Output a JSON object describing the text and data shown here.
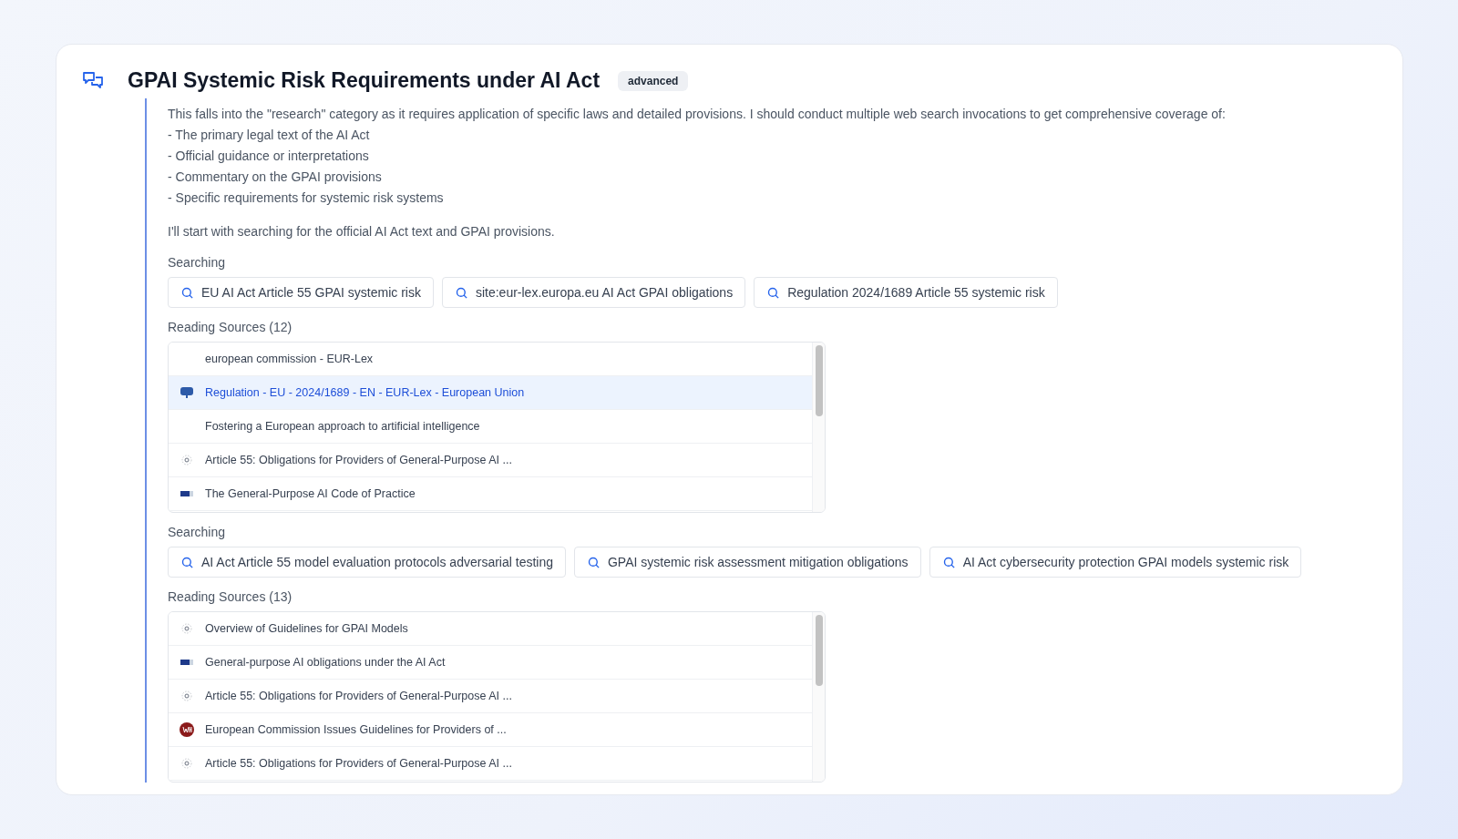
{
  "title": "GPAI Systemic Risk Requirements under AI Act",
  "badge": "advanced",
  "paragraphs": [
    "This falls into the \"research\" category as it requires application of specific laws and detailed provisions. I should conduct multiple web search invocations to get comprehensive coverage of:\n- The primary legal text of the AI Act\n- Official guidance or interpretations\n- Commentary on the GPAI provisions\n- Specific requirements for systemic risk systems",
    "I'll start with searching for the official AI Act text and GPAI provisions."
  ],
  "steps": [
    {
      "kind": "searching",
      "label": "Searching",
      "queries": [
        "EU AI Act Article 55 GPAI systemic risk",
        "site:eur-lex.europa.eu AI Act GPAI obligations",
        "Regulation 2024/1689 Article 55 systemic risk"
      ]
    },
    {
      "kind": "sources",
      "label": "Reading Sources (12)",
      "sources": [
        {
          "title": "european commission - EUR-Lex",
          "kind": "none",
          "selected": false
        },
        {
          "title": "Regulation - EU - 2024/1689 - EN - EUR-Lex - European Union",
          "kind": "monitor",
          "selected": true
        },
        {
          "title": "Fostering a European approach to artificial intelligence",
          "kind": "none",
          "selected": false
        },
        {
          "title": "Article 55: Obligations for Providers of General-Purpose AI ...",
          "kind": "dot",
          "selected": false
        },
        {
          "title": "The General-Purpose AI Code of Practice",
          "kind": "flag",
          "selected": false
        }
      ]
    },
    {
      "kind": "searching",
      "label": "Searching",
      "queries": [
        "AI Act Article 55 model evaluation protocols adversarial testing",
        "GPAI systemic risk assessment mitigation obligations",
        "AI Act cybersecurity protection GPAI models systemic risk"
      ]
    },
    {
      "kind": "sources",
      "label": "Reading Sources (13)",
      "sources": [
        {
          "title": "Overview of Guidelines for GPAI Models",
          "kind": "dot",
          "selected": false
        },
        {
          "title": "General-purpose AI obligations under the AI Act",
          "kind": "flag",
          "selected": false
        },
        {
          "title": "Article 55: Obligations for Providers of General-Purpose AI ...",
          "kind": "dot",
          "selected": false
        },
        {
          "title": "European Commission Issues Guidelines for Providers of ...",
          "kind": "badge",
          "selected": false
        },
        {
          "title": "Article 55: Obligations for Providers of General-Purpose AI ...",
          "kind": "dot",
          "selected": false
        }
      ]
    }
  ]
}
